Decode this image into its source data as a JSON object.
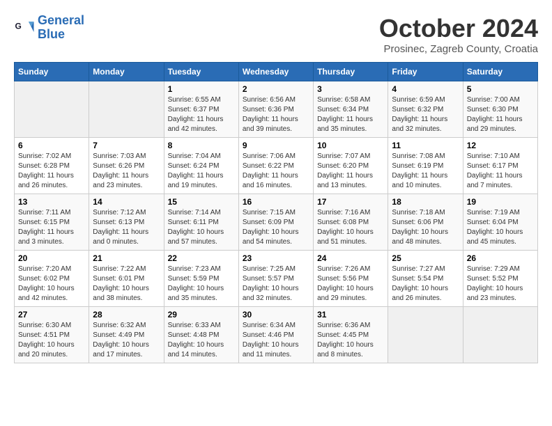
{
  "header": {
    "logo_line1": "General",
    "logo_line2": "Blue",
    "month_title": "October 2024",
    "subtitle": "Prosinec, Zagreb County, Croatia"
  },
  "weekdays": [
    "Sunday",
    "Monday",
    "Tuesday",
    "Wednesday",
    "Thursday",
    "Friday",
    "Saturday"
  ],
  "weeks": [
    [
      {
        "num": "",
        "empty": true
      },
      {
        "num": "",
        "empty": true
      },
      {
        "num": "1",
        "sunrise": "6:55 AM",
        "sunset": "6:37 PM",
        "daylight": "11 hours and 42 minutes."
      },
      {
        "num": "2",
        "sunrise": "6:56 AM",
        "sunset": "6:36 PM",
        "daylight": "11 hours and 39 minutes."
      },
      {
        "num": "3",
        "sunrise": "6:58 AM",
        "sunset": "6:34 PM",
        "daylight": "11 hours and 35 minutes."
      },
      {
        "num": "4",
        "sunrise": "6:59 AM",
        "sunset": "6:32 PM",
        "daylight": "11 hours and 32 minutes."
      },
      {
        "num": "5",
        "sunrise": "7:00 AM",
        "sunset": "6:30 PM",
        "daylight": "11 hours and 29 minutes."
      }
    ],
    [
      {
        "num": "6",
        "sunrise": "7:02 AM",
        "sunset": "6:28 PM",
        "daylight": "11 hours and 26 minutes."
      },
      {
        "num": "7",
        "sunrise": "7:03 AM",
        "sunset": "6:26 PM",
        "daylight": "11 hours and 23 minutes."
      },
      {
        "num": "8",
        "sunrise": "7:04 AM",
        "sunset": "6:24 PM",
        "daylight": "11 hours and 19 minutes."
      },
      {
        "num": "9",
        "sunrise": "7:06 AM",
        "sunset": "6:22 PM",
        "daylight": "11 hours and 16 minutes."
      },
      {
        "num": "10",
        "sunrise": "7:07 AM",
        "sunset": "6:20 PM",
        "daylight": "11 hours and 13 minutes."
      },
      {
        "num": "11",
        "sunrise": "7:08 AM",
        "sunset": "6:19 PM",
        "daylight": "11 hours and 10 minutes."
      },
      {
        "num": "12",
        "sunrise": "7:10 AM",
        "sunset": "6:17 PM",
        "daylight": "11 hours and 7 minutes."
      }
    ],
    [
      {
        "num": "13",
        "sunrise": "7:11 AM",
        "sunset": "6:15 PM",
        "daylight": "11 hours and 3 minutes."
      },
      {
        "num": "14",
        "sunrise": "7:12 AM",
        "sunset": "6:13 PM",
        "daylight": "11 hours and 0 minutes."
      },
      {
        "num": "15",
        "sunrise": "7:14 AM",
        "sunset": "6:11 PM",
        "daylight": "10 hours and 57 minutes."
      },
      {
        "num": "16",
        "sunrise": "7:15 AM",
        "sunset": "6:09 PM",
        "daylight": "10 hours and 54 minutes."
      },
      {
        "num": "17",
        "sunrise": "7:16 AM",
        "sunset": "6:08 PM",
        "daylight": "10 hours and 51 minutes."
      },
      {
        "num": "18",
        "sunrise": "7:18 AM",
        "sunset": "6:06 PM",
        "daylight": "10 hours and 48 minutes."
      },
      {
        "num": "19",
        "sunrise": "7:19 AM",
        "sunset": "6:04 PM",
        "daylight": "10 hours and 45 minutes."
      }
    ],
    [
      {
        "num": "20",
        "sunrise": "7:20 AM",
        "sunset": "6:02 PM",
        "daylight": "10 hours and 42 minutes."
      },
      {
        "num": "21",
        "sunrise": "7:22 AM",
        "sunset": "6:01 PM",
        "daylight": "10 hours and 38 minutes."
      },
      {
        "num": "22",
        "sunrise": "7:23 AM",
        "sunset": "5:59 PM",
        "daylight": "10 hours and 35 minutes."
      },
      {
        "num": "23",
        "sunrise": "7:25 AM",
        "sunset": "5:57 PM",
        "daylight": "10 hours and 32 minutes."
      },
      {
        "num": "24",
        "sunrise": "7:26 AM",
        "sunset": "5:56 PM",
        "daylight": "10 hours and 29 minutes."
      },
      {
        "num": "25",
        "sunrise": "7:27 AM",
        "sunset": "5:54 PM",
        "daylight": "10 hours and 26 minutes."
      },
      {
        "num": "26",
        "sunrise": "7:29 AM",
        "sunset": "5:52 PM",
        "daylight": "10 hours and 23 minutes."
      }
    ],
    [
      {
        "num": "27",
        "sunrise": "6:30 AM",
        "sunset": "4:51 PM",
        "daylight": "10 hours and 20 minutes."
      },
      {
        "num": "28",
        "sunrise": "6:32 AM",
        "sunset": "4:49 PM",
        "daylight": "10 hours and 17 minutes."
      },
      {
        "num": "29",
        "sunrise": "6:33 AM",
        "sunset": "4:48 PM",
        "daylight": "10 hours and 14 minutes."
      },
      {
        "num": "30",
        "sunrise": "6:34 AM",
        "sunset": "4:46 PM",
        "daylight": "10 hours and 11 minutes."
      },
      {
        "num": "31",
        "sunrise": "6:36 AM",
        "sunset": "4:45 PM",
        "daylight": "10 hours and 8 minutes."
      },
      {
        "num": "",
        "empty": true
      },
      {
        "num": "",
        "empty": true
      }
    ]
  ],
  "labels": {
    "sunrise": "Sunrise:",
    "sunset": "Sunset:",
    "daylight": "Daylight:"
  }
}
